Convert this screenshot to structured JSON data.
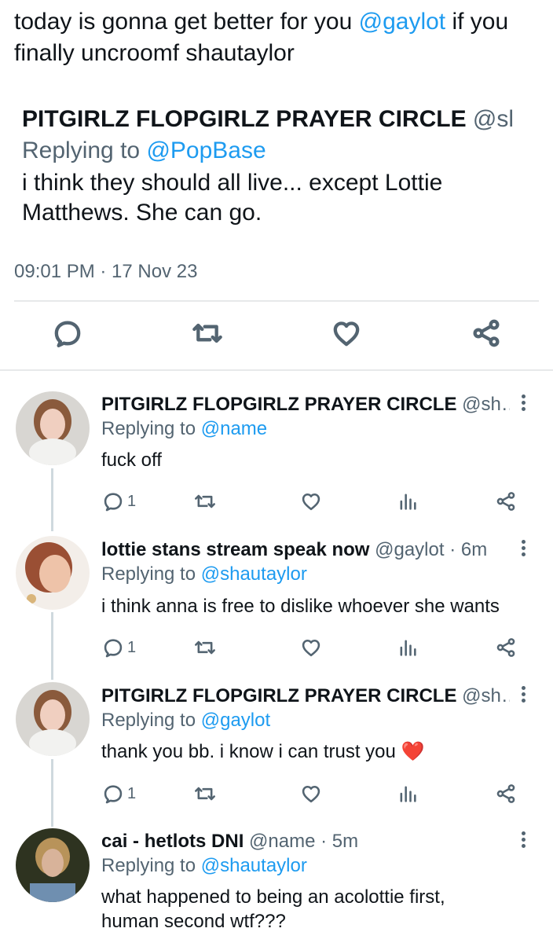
{
  "tweet": {
    "text_part1": "today is gonna get better for you ",
    "mention": "@gaylot",
    "text_part2": " if you finally uncroomf shautaylor"
  },
  "quote": {
    "name": "PITGIRLZ FLOPGIRLZ PRAYER CIRCLE",
    "handle": "@sl",
    "replying_label": "Replying to ",
    "replying_to": "@PopBase",
    "body": "i think they should all live... except Lottie Matthews. She can go."
  },
  "timestamp": "09:01 PM · 17 Nov 23",
  "icons": [
    "reply-icon",
    "retweet-icon",
    "like-icon",
    "share-icon",
    "views-icon",
    "more-icon"
  ],
  "replies": [
    {
      "name": "PITGIRLZ FLOPGIRLZ PRAYER CIRCLE",
      "handle": "@sh…",
      "replying_label": "Replying to ",
      "replying_to": "@name",
      "body": "fuck off",
      "reply_count": "1"
    },
    {
      "name": "lottie stans stream speak now",
      "handle": "@gaylot · 6m",
      "replying_label": "Replying to ",
      "replying_to": "@shautaylor",
      "body": "i think anna is free to dislike whoever she wants",
      "reply_count": "1"
    },
    {
      "name": "PITGIRLZ FLOPGIRLZ PRAYER CIRCLE",
      "handle": "@sh…",
      "replying_label": "Replying to ",
      "replying_to": "@gaylot",
      "body": "thank you bb. i know i can trust you ❤️",
      "reply_count": "1"
    },
    {
      "name": "cai - hetlots DNI",
      "handle": "@name · 5m",
      "replying_label": "Replying to ",
      "replying_to": "@shautaylor",
      "body": "what happened to being an acolottie first, human second wtf???"
    }
  ],
  "colors": {
    "link": "#1d9bf0",
    "secondary_text": "#536471",
    "divider": "#e7e9ea",
    "heart": "#e0245e"
  }
}
